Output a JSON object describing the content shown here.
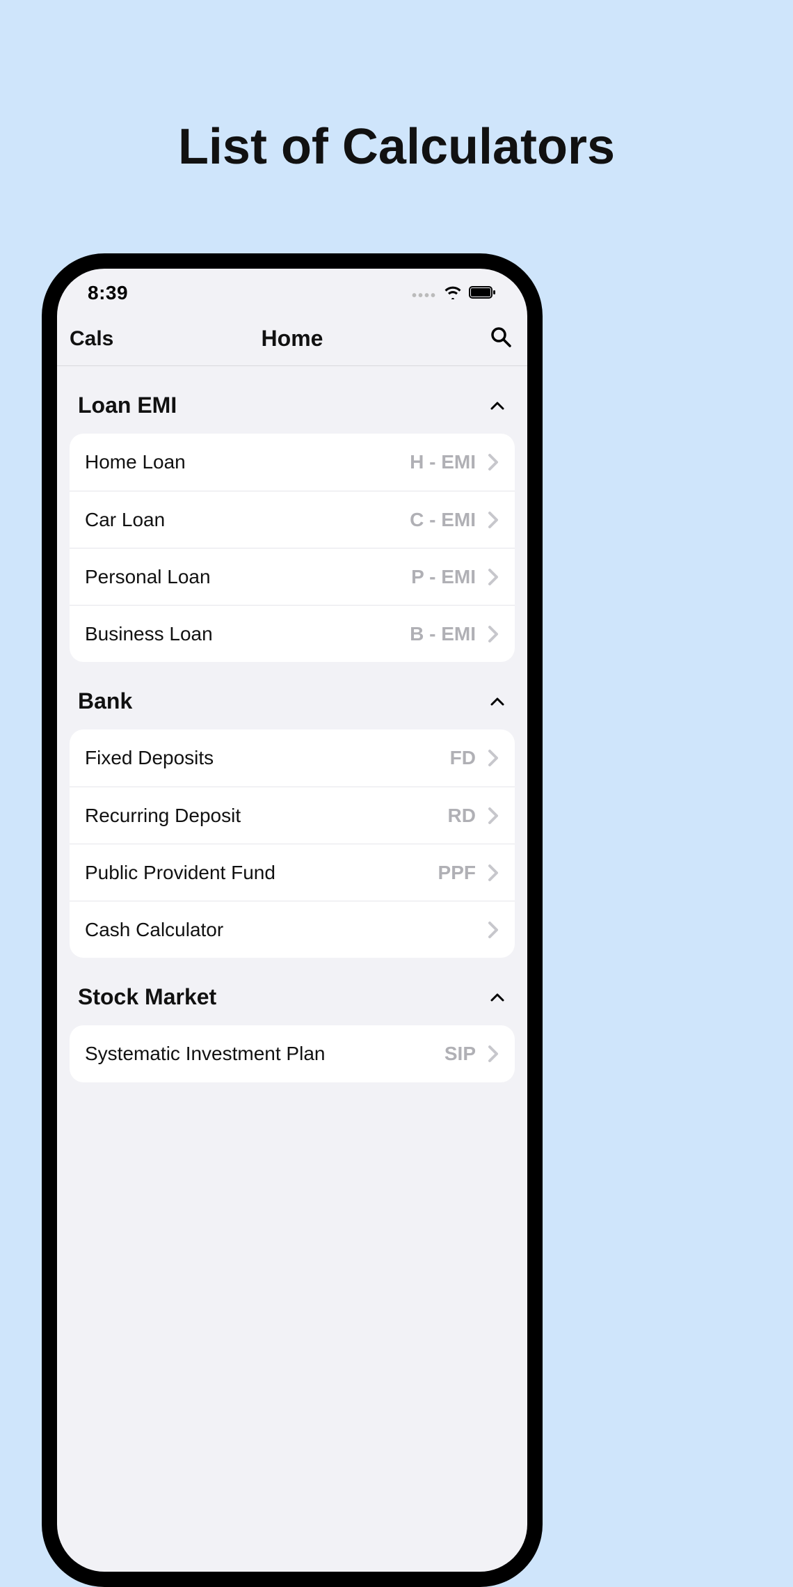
{
  "hero": {
    "title": "List of Calculators"
  },
  "status": {
    "time": "8:39"
  },
  "nav": {
    "left": "Cals",
    "title": "Home"
  },
  "sections": [
    {
      "title": "Loan EMI",
      "items": [
        {
          "label": "Home Loan",
          "code": "H - EMI"
        },
        {
          "label": "Car Loan",
          "code": "C - EMI"
        },
        {
          "label": "Personal Loan",
          "code": "P - EMI"
        },
        {
          "label": "Business Loan",
          "code": "B - EMI"
        }
      ]
    },
    {
      "title": "Bank",
      "items": [
        {
          "label": "Fixed Deposits",
          "code": "FD"
        },
        {
          "label": "Recurring Deposit",
          "code": "RD"
        },
        {
          "label": "Public Provident Fund",
          "code": "PPF"
        },
        {
          "label": "Cash Calculator",
          "code": ""
        }
      ]
    },
    {
      "title": "Stock Market",
      "items": [
        {
          "label": "Systematic Investment Plan",
          "code": "SIP"
        }
      ]
    }
  ]
}
